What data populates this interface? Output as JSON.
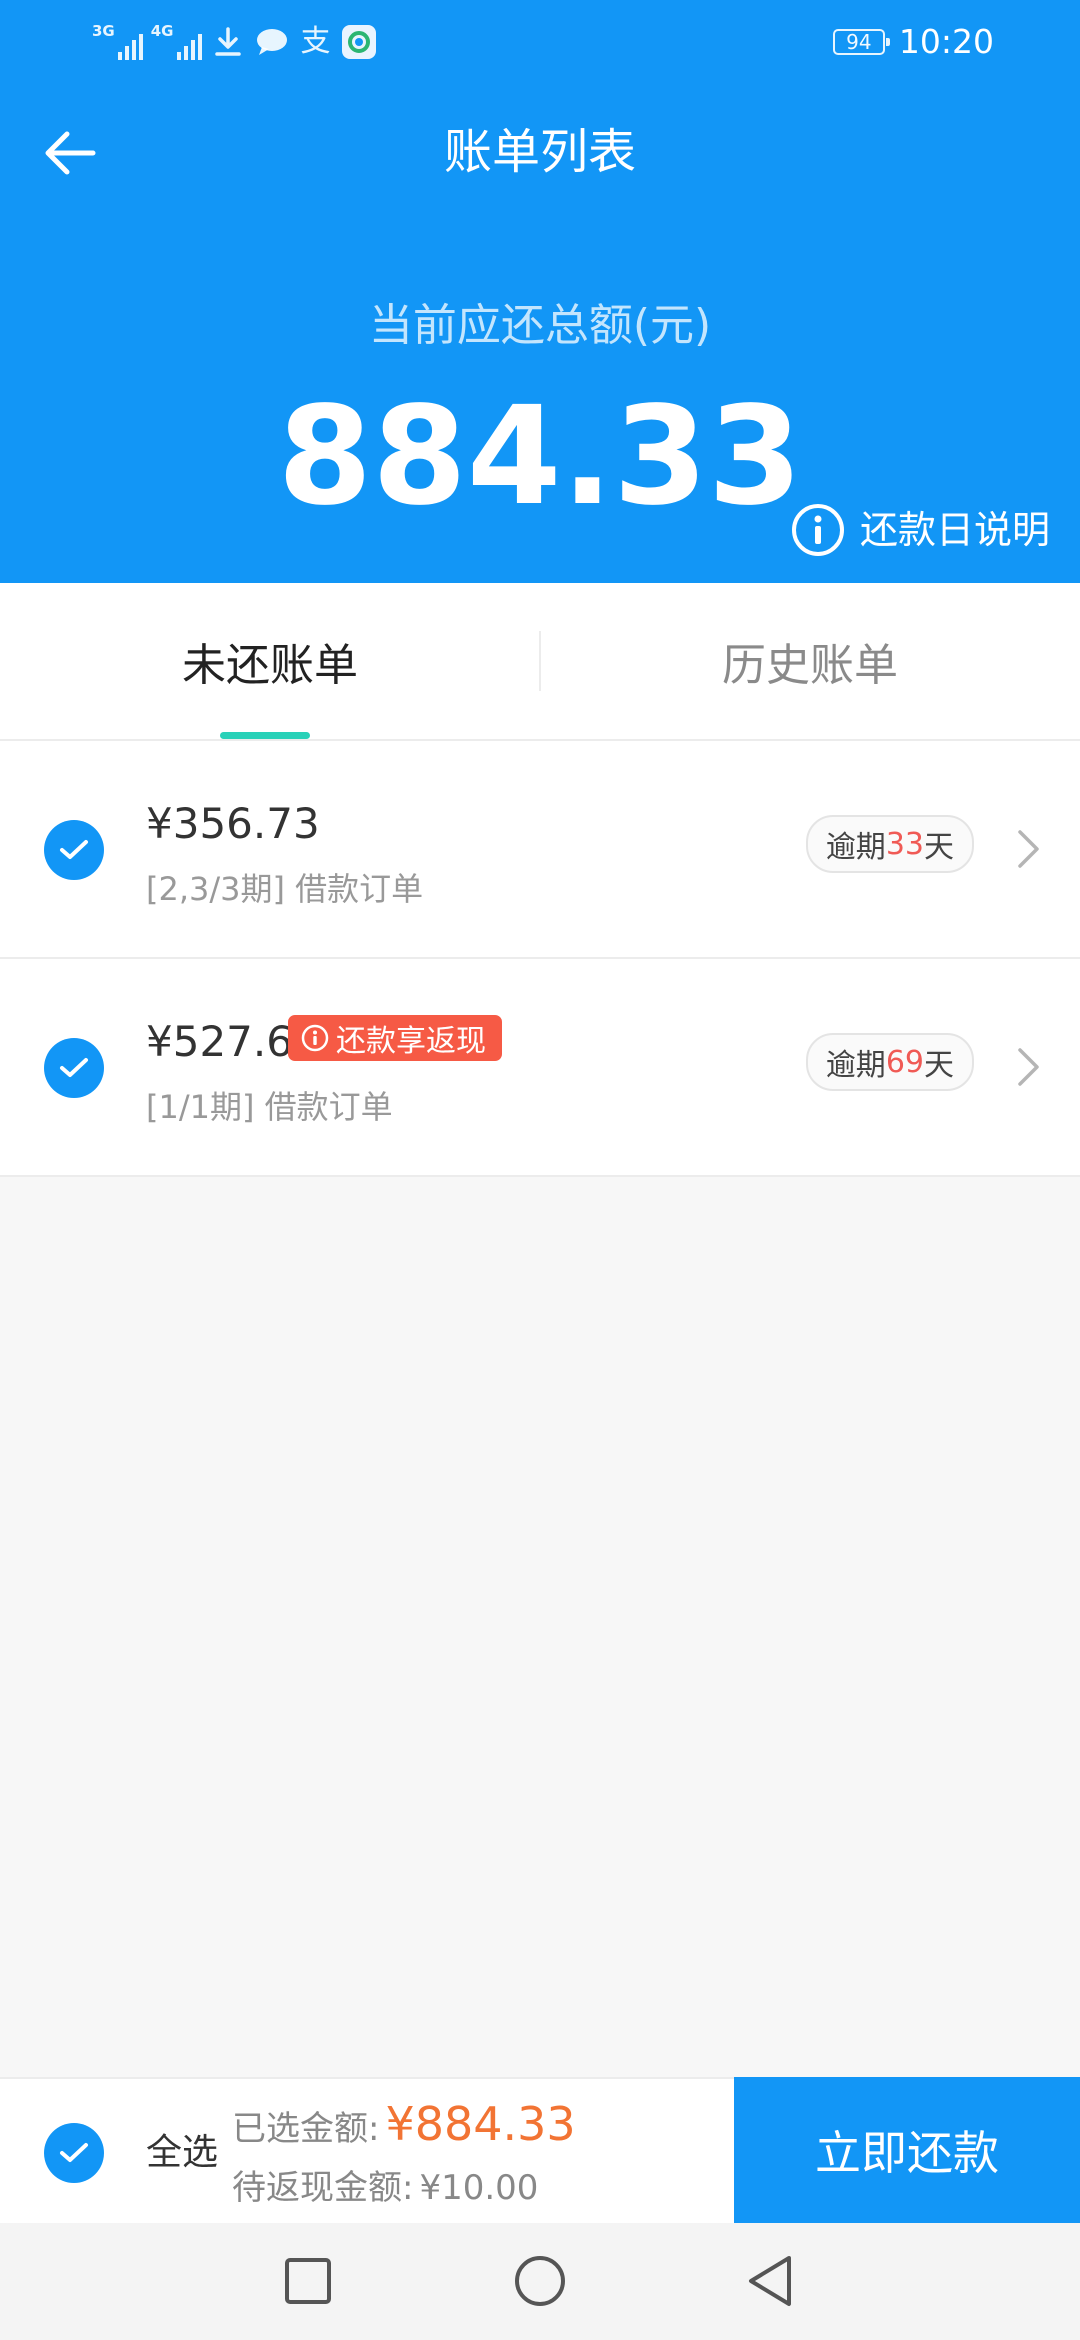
{
  "status_bar": {
    "network_1": "3G",
    "network_2": "4G",
    "alipay_glyph": "支",
    "battery": "94",
    "time": "10:20",
    "icons": [
      "signal-icon",
      "download-icon",
      "message-icon",
      "alipay-icon",
      "app-icon",
      "battery-icon"
    ]
  },
  "header": {
    "title": "账单列表",
    "total_label": "当前应还总额(元)",
    "total_amount": "884.33",
    "due_info_label": "还款日说明"
  },
  "tabs": [
    {
      "label": "未还账单",
      "active": true
    },
    {
      "label": "历史账单",
      "active": false
    }
  ],
  "bills": [
    {
      "amount": "¥356.73",
      "desc": "[2,3/3期] 借款订单",
      "overdue_prefix": "逾期",
      "overdue_days": "33",
      "overdue_suffix": "天",
      "checked": true
    },
    {
      "amount": "¥527.6",
      "promo": "还款享返现",
      "desc": "[1/1期] 借款订单",
      "overdue_prefix": "逾期",
      "overdue_days": "69",
      "overdue_suffix": "天",
      "checked": true
    }
  ],
  "bottom_bar": {
    "select_all_label": "全选",
    "selected_label": "已选金额:",
    "selected_amount": "¥884.33",
    "cashback_label": "待返现金额:",
    "cashback_amount": "¥10.00",
    "pay_button": "立即还款"
  },
  "colors": {
    "primary": "#1296f6",
    "tab_indicator": "#29d1b8",
    "promo": "#f65a45",
    "overdue_days": "#f05a55",
    "selected_amount": "#f27434"
  }
}
